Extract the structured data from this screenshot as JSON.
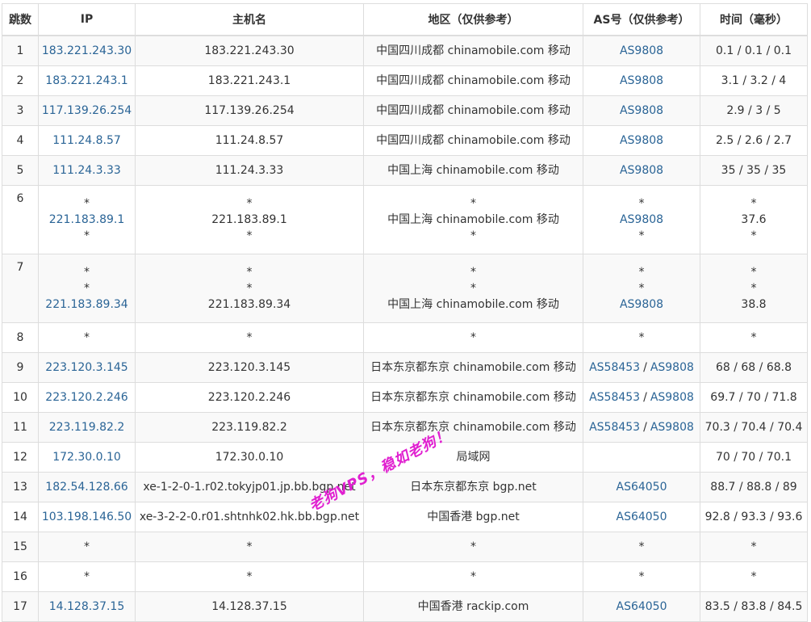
{
  "headers": [
    "跳数",
    "IP",
    "主机名",
    "地区（仅供参考）",
    "AS号（仅供参考）",
    "时间（毫秒）"
  ],
  "rows": [
    {
      "hop": "1",
      "ip": [
        "183.221.243.30"
      ],
      "host": [
        "183.221.243.30"
      ],
      "region": [
        "中国四川成都 chinamobile.com 移动"
      ],
      "as": [
        [
          "AS9808"
        ]
      ],
      "time": [
        "0.1 / 0.1 / 0.1"
      ]
    },
    {
      "hop": "2",
      "ip": [
        "183.221.243.1"
      ],
      "host": [
        "183.221.243.1"
      ],
      "region": [
        "中国四川成都 chinamobile.com 移动"
      ],
      "as": [
        [
          "AS9808"
        ]
      ],
      "time": [
        "3.1 / 3.2 / 4"
      ]
    },
    {
      "hop": "3",
      "ip": [
        "117.139.26.254"
      ],
      "host": [
        "117.139.26.254"
      ],
      "region": [
        "中国四川成都 chinamobile.com 移动"
      ],
      "as": [
        [
          "AS9808"
        ]
      ],
      "time": [
        "2.9 / 3 / 5"
      ]
    },
    {
      "hop": "4",
      "ip": [
        "111.24.8.57"
      ],
      "host": [
        "111.24.8.57"
      ],
      "region": [
        "中国四川成都 chinamobile.com 移动"
      ],
      "as": [
        [
          "AS9808"
        ]
      ],
      "time": [
        "2.5 / 2.6 / 2.7"
      ]
    },
    {
      "hop": "5",
      "ip": [
        "111.24.3.33"
      ],
      "host": [
        "111.24.3.33"
      ],
      "region": [
        "中国上海 chinamobile.com 移动"
      ],
      "as": [
        [
          "AS9808"
        ]
      ],
      "time": [
        "35 / 35 / 35"
      ]
    },
    {
      "hop": "6",
      "ip": [
        "*",
        "221.183.89.1",
        "*"
      ],
      "host": [
        "*",
        "221.183.89.1",
        "*"
      ],
      "region": [
        "*",
        "中国上海 chinamobile.com 移动",
        "*"
      ],
      "as": [
        [
          "*"
        ],
        [
          "AS9808"
        ],
        [
          "*"
        ]
      ],
      "time": [
        "*",
        "37.6",
        "*"
      ]
    },
    {
      "hop": "7",
      "ip": [
        "*",
        "*",
        "221.183.89.34"
      ],
      "host": [
        "*",
        "*",
        "221.183.89.34"
      ],
      "region": [
        "*",
        "*",
        "中国上海 chinamobile.com 移动"
      ],
      "as": [
        [
          "*"
        ],
        [
          "*"
        ],
        [
          "AS9808"
        ]
      ],
      "time": [
        "*",
        "*",
        "38.8"
      ]
    },
    {
      "hop": "8",
      "ip": [
        "*"
      ],
      "host": [
        "*"
      ],
      "region": [
        "*"
      ],
      "as": [
        [
          "*"
        ]
      ],
      "time": [
        "*"
      ]
    },
    {
      "hop": "9",
      "ip": [
        "223.120.3.145"
      ],
      "host": [
        "223.120.3.145"
      ],
      "region": [
        "日本东京都东京 chinamobile.com 移动"
      ],
      "as": [
        [
          "AS58453",
          "AS9808"
        ]
      ],
      "time": [
        "68 / 68 / 68.8"
      ]
    },
    {
      "hop": "10",
      "ip": [
        "223.120.2.246"
      ],
      "host": [
        "223.120.2.246"
      ],
      "region": [
        "日本东京都东京 chinamobile.com 移动"
      ],
      "as": [
        [
          "AS58453",
          "AS9808"
        ]
      ],
      "time": [
        "69.7 / 70 / 71.8"
      ]
    },
    {
      "hop": "11",
      "ip": [
        "223.119.82.2"
      ],
      "host": [
        "223.119.82.2"
      ],
      "region": [
        "日本东京都东京 chinamobile.com 移动"
      ],
      "as": [
        [
          "AS58453",
          "AS9808"
        ]
      ],
      "time": [
        "70.3 / 70.4 / 70.4"
      ]
    },
    {
      "hop": "12",
      "ip": [
        "172.30.0.10"
      ],
      "host": [
        "172.30.0.10"
      ],
      "region": [
        "局域网"
      ],
      "as": [
        []
      ],
      "time": [
        "70 / 70 / 70.1"
      ]
    },
    {
      "hop": "13",
      "ip": [
        "182.54.128.66"
      ],
      "host": [
        "xe-1-2-0-1.r02.tokyjp01.jp.bb.bgp.net"
      ],
      "region": [
        "日本东京都东京 bgp.net"
      ],
      "as": [
        [
          "AS64050"
        ]
      ],
      "time": [
        "88.7 / 88.8 / 89"
      ]
    },
    {
      "hop": "14",
      "ip": [
        "103.198.146.50"
      ],
      "host": [
        "xe-3-2-2-0.r01.shtnhk02.hk.bb.bgp.net"
      ],
      "region": [
        "中国香港 bgp.net"
      ],
      "as": [
        [
          "AS64050"
        ]
      ],
      "time": [
        "92.8 / 93.3 / 93.6"
      ]
    },
    {
      "hop": "15",
      "ip": [
        "*"
      ],
      "host": [
        "*"
      ],
      "region": [
        "*"
      ],
      "as": [
        [
          "*"
        ]
      ],
      "time": [
        "*"
      ]
    },
    {
      "hop": "16",
      "ip": [
        "*"
      ],
      "host": [
        "*"
      ],
      "region": [
        "*"
      ],
      "as": [
        [
          "*"
        ]
      ],
      "time": [
        "*"
      ]
    },
    {
      "hop": "17",
      "ip": [
        "14.128.37.15"
      ],
      "host": [
        "14.128.37.15"
      ],
      "region": [
        "中国香港 rackip.com"
      ],
      "as": [
        [
          "AS64050"
        ]
      ],
      "time": [
        "83.5 / 83.8 / 84.5"
      ]
    }
  ],
  "watermark": "老狗VPS，稳如老狗！",
  "colors": {
    "link": "#2a6496",
    "border": "#dddddd",
    "stripe": "#f9f9f9",
    "watermark": "#e020d0"
  }
}
